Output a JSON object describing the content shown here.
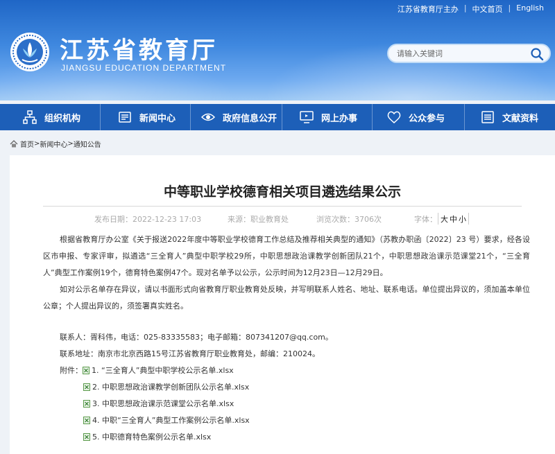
{
  "top_links": {
    "host": "江苏省教育厅主办",
    "home_cn": "中文首页",
    "english": "English"
  },
  "logo": {
    "title": "江苏省教育厅",
    "subtitle": "JIANGSU EDUCATION DEPARTMENT"
  },
  "search": {
    "placeholder": "请输入关键词"
  },
  "nav": [
    {
      "label": "组织机构",
      "icon": "org-chart-icon"
    },
    {
      "label": "新闻中心",
      "icon": "news-icon"
    },
    {
      "label": "政府信息公开",
      "icon": "eye-icon"
    },
    {
      "label": "网上办事",
      "icon": "monitor-icon"
    },
    {
      "label": "公众参与",
      "icon": "heart-icon"
    },
    {
      "label": "文献资料",
      "icon": "document-icon"
    }
  ],
  "breadcrumb": {
    "home": "首页",
    "news": "新闻中心",
    "notice": "通知公告",
    "sep": ">"
  },
  "article": {
    "title": "中等职业学校德育相关项目遴选结果公示",
    "publish_date": "发布日期：2022-12-23 17:03",
    "source": "来源：职业教育处",
    "views": "浏览次数：3706次",
    "font_label": "字体：",
    "font_big": "大",
    "font_mid": "中",
    "font_small": "小",
    "para1": "根据省教育厅办公室《关于报送2022年度中等职业学校德育工作总结及推荐相关典型的通知》（苏教办职函〔2022〕23 号）要求，经各设区市申报、专家评审，拟遴选“三全育人”典型中职学校29所，中职思想政治课教学创新团队21个，中职思想政治课示范课堂21个，“三全育人”典型工作案例19个，德育特色案例47个。现对名单予以公示，公示时间为12月23日—12月29日。",
    "para2": "如对公示名单存在异议，请以书面形式向省教育厅职业教育处反映，并写明联系人姓名、地址、联系电话。单位提出异议的，须加盖本单位公章；个人提出异议的，须签署真实姓名。",
    "contact": "联系人：胥科伟，电话：025-83335583；电子邮箱：807341207@qq.com。",
    "address": "联系地址：南京市北京西路15号江苏省教育厅职业教育处，邮编：210024。",
    "attachments_label": "附件：",
    "attachments": [
      "1. “三全育人”典型中职学校公示名单.xlsx",
      "2. 中职思想政治课教学创新团队公示名单.xlsx",
      "3. 中职思想政治课示范课堂公示名单.xlsx",
      "4. 中职“三全育人”典型工作案例公示名单.xlsx",
      "5. 中职德育特色案例公示名单.xlsx"
    ]
  }
}
